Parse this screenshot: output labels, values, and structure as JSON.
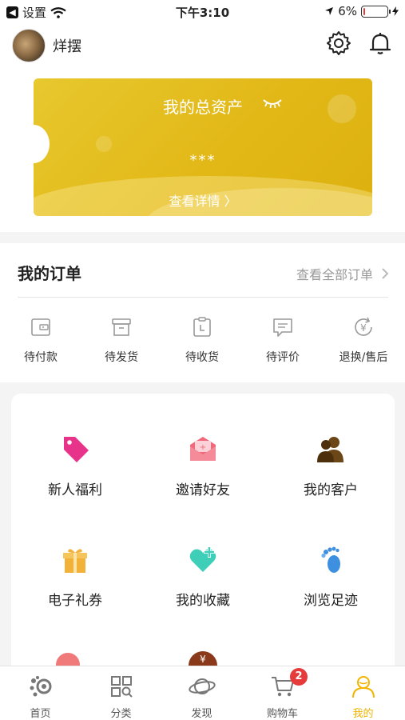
{
  "status_bar": {
    "back_app": "设置",
    "time": "下午3:10",
    "battery": "6%",
    "battery_level": 0.06
  },
  "profile": {
    "username": "烊摆"
  },
  "asset_card": {
    "title": "我的总资产",
    "value": "***",
    "detail_link": "查看详情 〉"
  },
  "orders": {
    "title": "我的订单",
    "view_all": "查看全部订单",
    "items": [
      {
        "label": "待付款",
        "icon": "wallet-icon"
      },
      {
        "label": "待发货",
        "icon": "box-icon"
      },
      {
        "label": "待收货",
        "icon": "clipboard-clock-icon"
      },
      {
        "label": "待评价",
        "icon": "chat-icon"
      },
      {
        "label": "退换/售后",
        "icon": "yen-refresh-icon"
      }
    ]
  },
  "services": [
    {
      "label": "新人福利",
      "icon": "tag-icon",
      "color": "#e8338a"
    },
    {
      "label": "邀请好友",
      "icon": "envelope-icon",
      "color": "#f0687a"
    },
    {
      "label": "我的客户",
      "icon": "people-icon",
      "color": "#5b3a14"
    },
    {
      "label": "电子礼券",
      "icon": "gift-icon",
      "color": "#f2b23a"
    },
    {
      "label": "我的收藏",
      "icon": "heart-plus-icon",
      "color": "#3fcfb8"
    },
    {
      "label": "浏览足迹",
      "icon": "footprint-icon",
      "color": "#3d8fe0"
    }
  ],
  "tabbar": {
    "items": [
      {
        "label": "首页",
        "icon": "home-icon"
      },
      {
        "label": "分类",
        "icon": "category-icon"
      },
      {
        "label": "发现",
        "icon": "planet-icon"
      },
      {
        "label": "购物车",
        "icon": "cart-icon",
        "badge": "2"
      },
      {
        "label": "我的",
        "icon": "user-icon"
      }
    ],
    "active_color": "#f2b400"
  }
}
